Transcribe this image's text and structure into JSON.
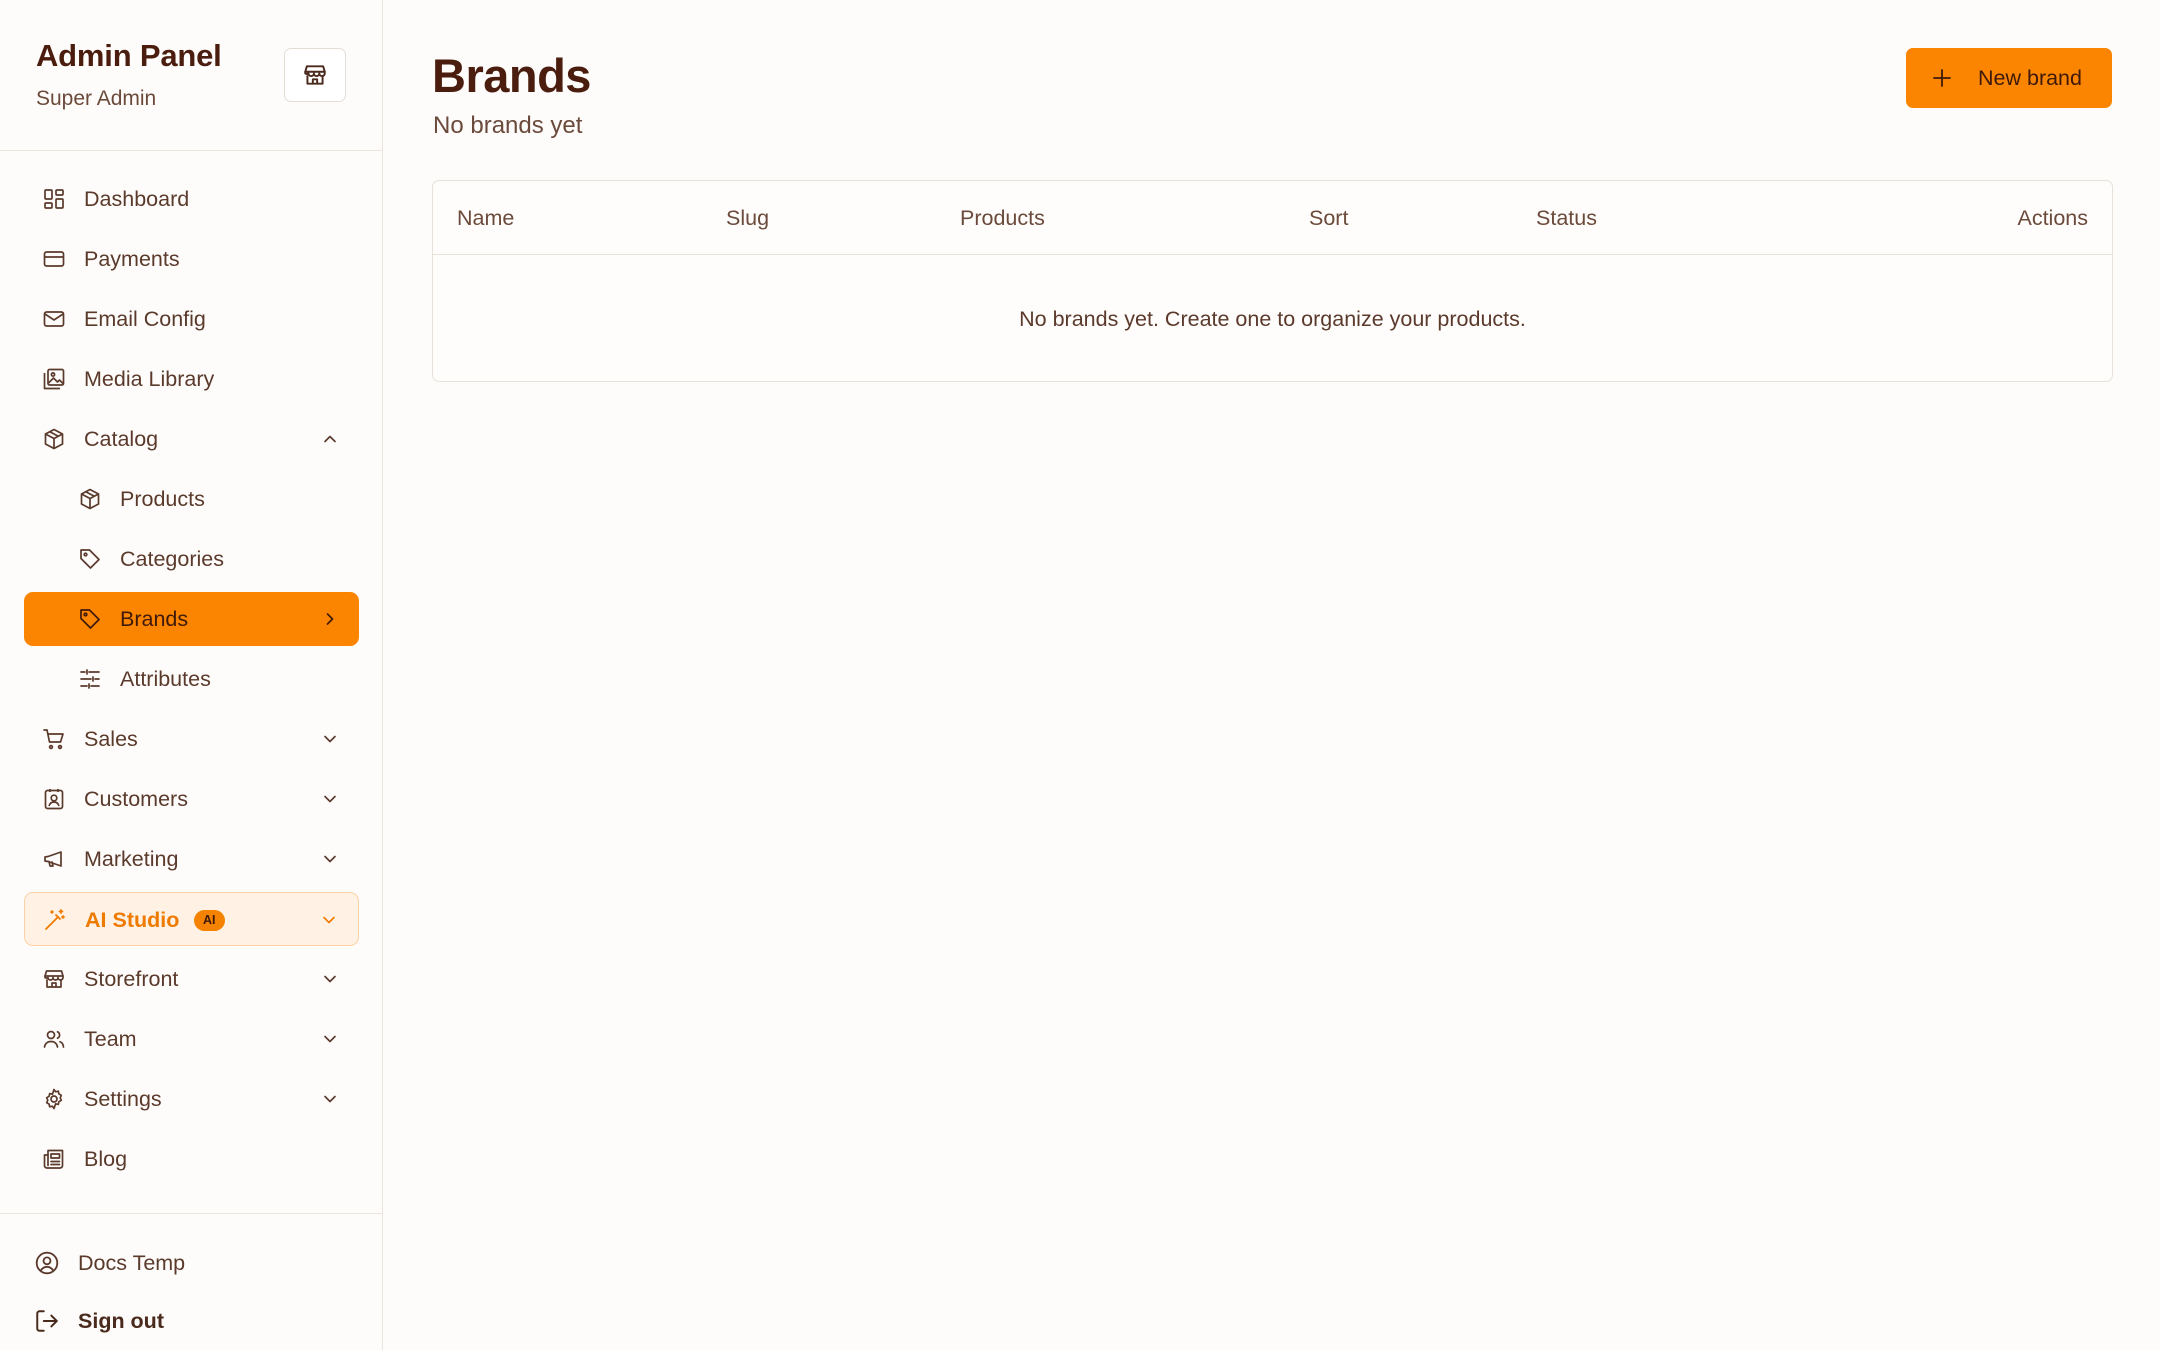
{
  "sidebar": {
    "title": "Admin Panel",
    "subtitle": "Super Admin",
    "items": [
      {
        "label": "Dashboard"
      },
      {
        "label": "Payments"
      },
      {
        "label": "Email Config"
      },
      {
        "label": "Media Library"
      },
      {
        "label": "Catalog"
      },
      {
        "label": "Products"
      },
      {
        "label": "Categories"
      },
      {
        "label": "Brands"
      },
      {
        "label": "Attributes"
      },
      {
        "label": "Sales"
      },
      {
        "label": "Customers"
      },
      {
        "label": "Marketing"
      },
      {
        "label": "AI Studio",
        "badge": "AI"
      },
      {
        "label": "Storefront"
      },
      {
        "label": "Team"
      },
      {
        "label": "Settings"
      },
      {
        "label": "Blog"
      }
    ],
    "footer": {
      "user": "Docs Temp",
      "signout": "Sign out"
    }
  },
  "main": {
    "title": "Brands",
    "subtitle": "No brands yet",
    "new_button": "New brand",
    "table": {
      "columns": [
        "Name",
        "Slug",
        "Products",
        "Sort",
        "Status",
        "Actions"
      ],
      "empty_message": "No brands yet. Create one to organize your products."
    }
  },
  "colors": {
    "accent": "#fb8500",
    "heading": "#4a1d0e",
    "text": "#5b3a2c",
    "background": "#fdfcfa",
    "border": "#ece5de"
  }
}
